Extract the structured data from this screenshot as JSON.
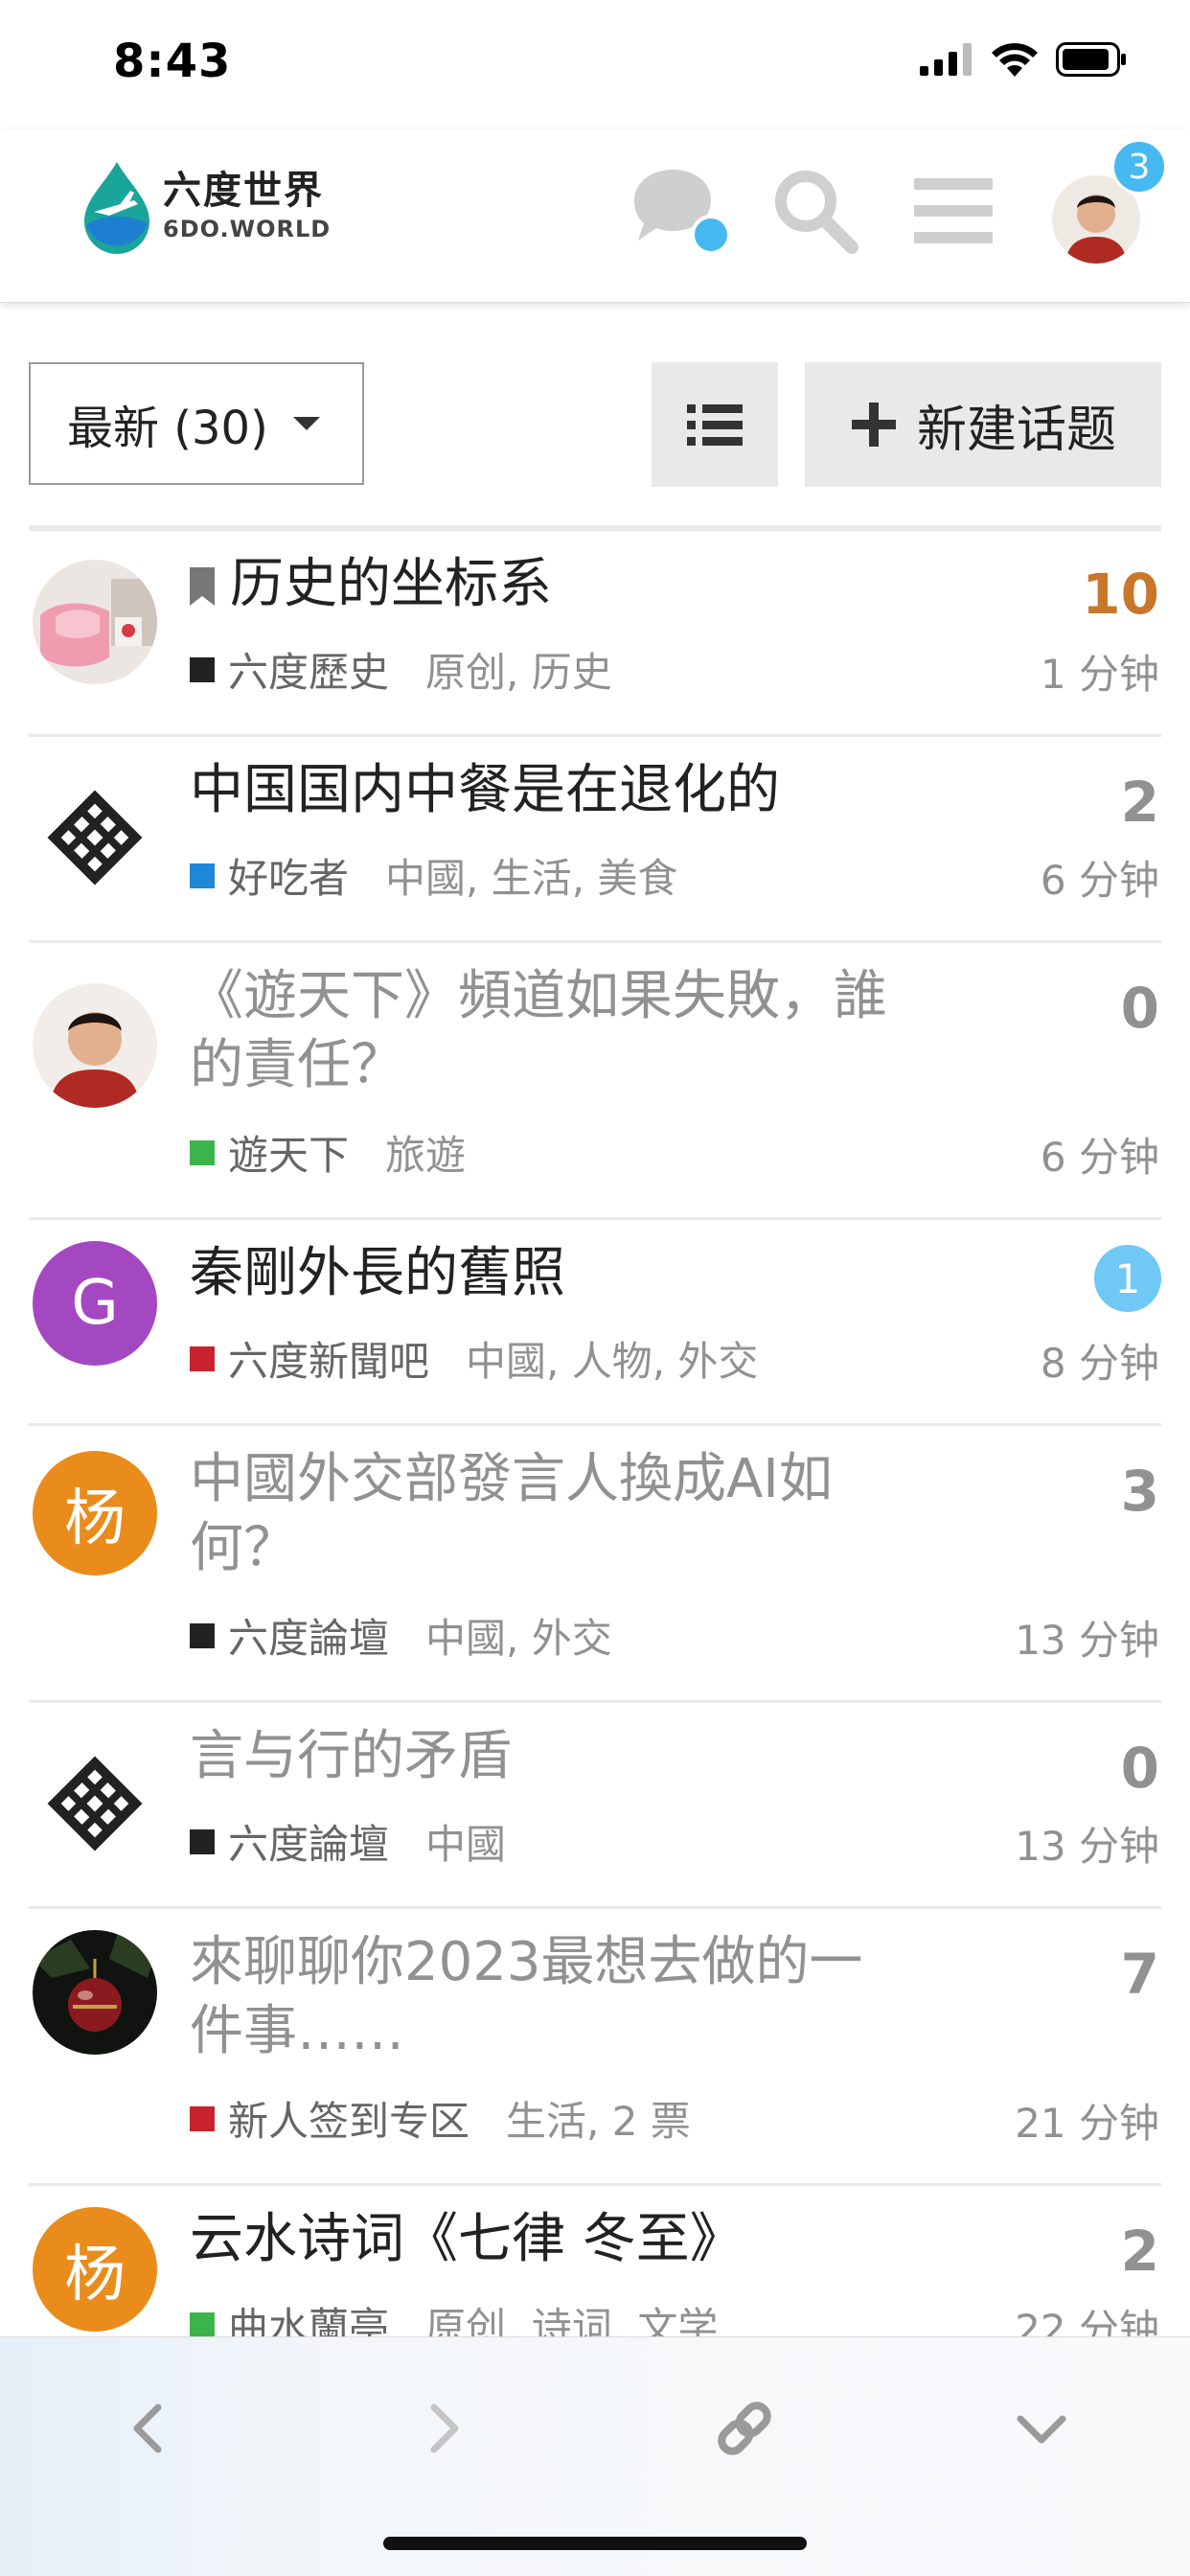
{
  "status_bar": {
    "time": "8:43"
  },
  "header": {
    "logo_cn": "六度世界",
    "logo_en": "6DO.WORLD",
    "notification_count": "3"
  },
  "controls": {
    "filter_label": "最新 (30)",
    "new_topic_label": "新建话题"
  },
  "topics": [
    {
      "title": "历史的坐标系",
      "category": "六度歷史",
      "category_color": "#222222",
      "tags": "原创, 历史",
      "count": "10",
      "time": "1 分钟"
    },
    {
      "title": "中国国内中餐是在退化的",
      "category": "好吃者",
      "category_color": "#1e88d6",
      "tags": "中國, 生活, 美食",
      "count": "2",
      "time": "6 分钟"
    },
    {
      "title_line1": "《遊天下》頻道如果失敗，誰",
      "title_line2": "的責任？",
      "category": "遊天下",
      "category_color": "#3bb54a",
      "tags": "旅遊",
      "count": "0",
      "time": "6 分钟"
    },
    {
      "title": "秦剛外長的舊照",
      "category": "六度新聞吧",
      "category_color": "#c8232c",
      "tags": "中國, 人物, 外交",
      "unread": "1",
      "time": "8 分钟",
      "avatar_letter": "G"
    },
    {
      "title_line1": "中國外交部發言人換成AI如",
      "title_line2": "何？",
      "category": "六度論壇",
      "category_color": "#222222",
      "tags": "中國, 外交",
      "count": "3",
      "time": "13 分钟",
      "avatar_letter": "杨"
    },
    {
      "title": "言与行的矛盾",
      "category": "六度論壇",
      "category_color": "#222222",
      "tags": "中國",
      "count": "0",
      "time": "13 分钟"
    },
    {
      "title_line1": "來聊聊你2023最想去做的一",
      "title_line2": "件事……",
      "category": "新人签到专区",
      "category_color": "#c8232c",
      "tags": "生活, 2 票",
      "count": "7",
      "time": "21 分钟"
    },
    {
      "title": "云水诗词《七律 冬至》",
      "category": "曲水蘭亭",
      "category_color": "#3bb54a",
      "tags": "原创, 诗词, 文学",
      "count": "2",
      "time": "22 分钟",
      "avatar_letter": "杨"
    }
  ],
  "colors": {
    "accent_blue": "#46b9f0",
    "hot_count": "#c8772b",
    "muted_text": "#919191"
  },
  "icons": {
    "header": [
      "chat-icon",
      "search-icon",
      "hamburger-menu-icon"
    ],
    "bottom_bar": [
      "back-arrow-icon",
      "forward-arrow-icon",
      "link-icon",
      "chevron-down-icon"
    ]
  }
}
